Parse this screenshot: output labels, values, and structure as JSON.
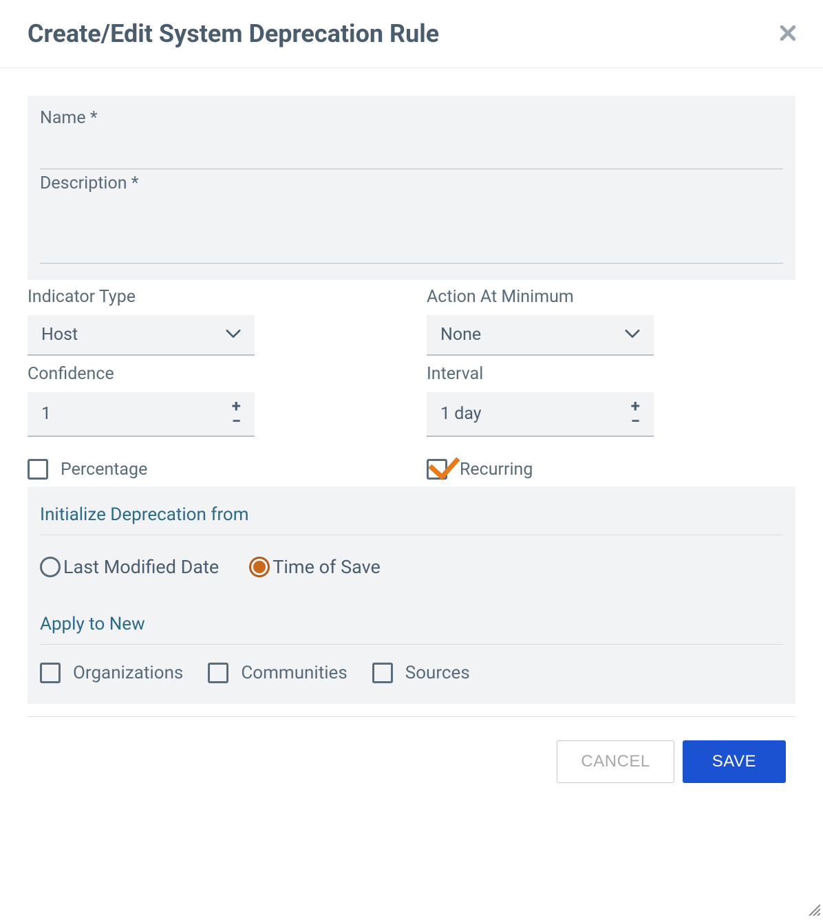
{
  "dialog": {
    "title": "Create/Edit System Deprecation Rule"
  },
  "fields": {
    "name_label": "Name *",
    "name_value": "",
    "description_label": "Description *",
    "description_value": "",
    "indicator_type_label": "Indicator Type",
    "indicator_type_value": "Host",
    "action_at_min_label": "Action At Minimum",
    "action_at_min_value": "None",
    "confidence_label": "Confidence",
    "confidence_value": "1",
    "interval_label": "Interval",
    "interval_value": "1 day",
    "percentage_label": "Percentage",
    "percentage_checked": false,
    "recurring_label": "Recurring",
    "recurring_checked": true
  },
  "init_section": {
    "title": "Initialize Deprecation from",
    "options": [
      {
        "label": "Last Modified Date",
        "selected": false
      },
      {
        "label": "Time of Save",
        "selected": true
      }
    ]
  },
  "apply_section": {
    "title": "Apply to New",
    "items": [
      {
        "label": "Organizations",
        "checked": false
      },
      {
        "label": "Communities",
        "checked": false
      },
      {
        "label": "Sources",
        "checked": false
      }
    ]
  },
  "buttons": {
    "cancel": "CANCEL",
    "save": "SAVE"
  }
}
